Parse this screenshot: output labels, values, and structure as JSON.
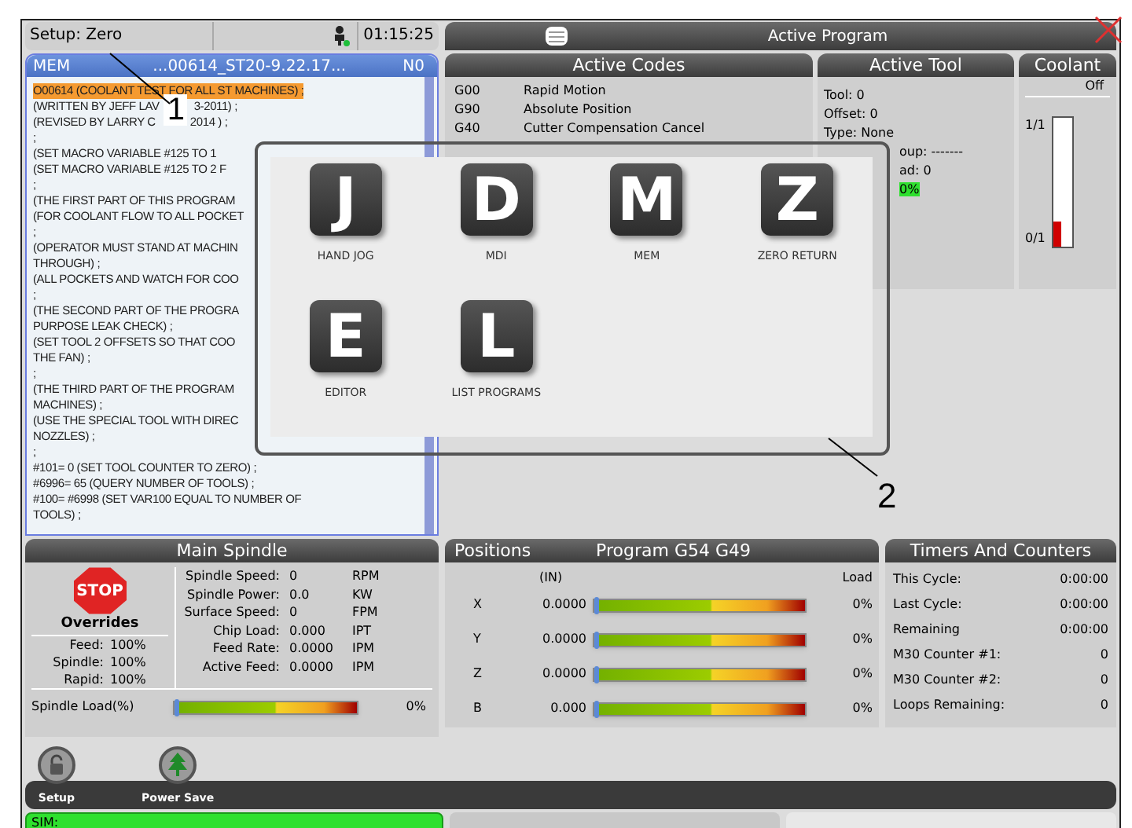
{
  "status_header": {
    "mode": "Setup: Zero",
    "time": "01:15:25"
  },
  "title_bar": {
    "title": "Active Program"
  },
  "program_panel": {
    "mode": "MEM",
    "name": "...00614_ST20-9.22.17...",
    "line": "N0",
    "lines": [
      {
        "text": "O00614 (COOLANT TEST FOR ALL ST MACHINES) ;",
        "selected": true
      },
      {
        "text": "(WRITTEN BY JEFF LAV",
        "after": "3-2011) ;",
        "selected": false
      },
      {
        "text": "(REVISED BY LARRY C",
        "after": "2014 ) ;",
        "selected": false
      },
      {
        "text": ";",
        "selected": false
      },
      {
        "text": "(SET MACRO VARIABLE #125 TO 1",
        "selected": false
      },
      {
        "text": "(SET MACRO VARIABLE #125 TO 2 F",
        "selected": false
      },
      {
        "text": ";",
        "selected": false
      },
      {
        "text": "(THE FIRST PART OF THIS PROGRAM",
        "selected": false
      },
      {
        "text": "(FOR COOLANT FLOW TO ALL POCKET",
        "selected": false
      },
      {
        "text": ";",
        "selected": false
      },
      {
        "text": "(OPERATOR MUST STAND AT MACHIN",
        "selected": false
      },
      {
        "text": "THROUGH) ;",
        "selected": false
      },
      {
        "text": "(ALL POCKETS AND WATCH FOR COO",
        "selected": false
      },
      {
        "text": ";",
        "selected": false
      },
      {
        "text": "(THE SECOND PART OF THE PROGRA",
        "selected": false
      },
      {
        "text": "PURPOSE LEAK CHECK) ;",
        "selected": false
      },
      {
        "text": "(SET TOOL 2 OFFSETS SO THAT COO",
        "selected": false
      },
      {
        "text": "THE FAN) ;",
        "selected": false
      },
      {
        "text": ";",
        "selected": false
      },
      {
        "text": "(THE THIRD PART OF THE PROGRAM",
        "selected": false
      },
      {
        "text": "MACHINES) ;",
        "selected": false
      },
      {
        "text": "(USE THE SPECIAL TOOL WITH DIREC",
        "selected": false
      },
      {
        "text": "NOZZLES) ;",
        "selected": false
      },
      {
        "text": ";",
        "selected": false
      },
      {
        "text": "#101= 0 (SET TOOL COUNTER TO ZERO) ;",
        "selected": false
      },
      {
        "text": "#6996= 65 (QUERY NUMBER OF TOOLS) ;",
        "selected": false
      },
      {
        "text": "#100= #6998 (SET VAR100 EQUAL TO NUMBER OF",
        "selected": false
      },
      {
        "text": "TOOLS) ;",
        "selected": false
      }
    ]
  },
  "active_codes": {
    "title": "Active Codes",
    "rows": [
      {
        "code": "G00",
        "description": "Rapid Motion"
      },
      {
        "code": "G90",
        "description": "Absolute Position"
      },
      {
        "code": "G40",
        "description": "Cutter Compensation Cancel"
      }
    ]
  },
  "active_tool": {
    "title": "Active Tool",
    "rows": [
      {
        "kind": "full",
        "text": "Tool: 0"
      },
      {
        "kind": "full",
        "text": "Offset: 0"
      },
      {
        "kind": "full",
        "text": "Type: None"
      },
      {
        "kind": "clipped",
        "text": "oup: -------"
      },
      {
        "kind": "clipped",
        "text": "ad: 0"
      },
      {
        "kind": "highlight",
        "text": "0%"
      }
    ]
  },
  "coolant": {
    "title": "Coolant",
    "state": "Off",
    "top_label": "1/1",
    "bottom_label": "0/1",
    "level": 0.2
  },
  "mode_menu": {
    "items": [
      {
        "key": "J",
        "label": "HAND JOG"
      },
      {
        "key": "D",
        "label": "MDI"
      },
      {
        "key": "M",
        "label": "MEM"
      },
      {
        "key": "Z",
        "label": "ZERO RETURN"
      },
      {
        "key": "E",
        "label": "EDITOR"
      },
      {
        "key": "L",
        "label": "LIST PROGRAMS"
      }
    ]
  },
  "callouts": [
    {
      "label": "1"
    },
    {
      "label": "2"
    }
  ],
  "main_spindle": {
    "title": "Main Spindle",
    "stop_label": "STOP",
    "overrides_title": "Overrides",
    "overrides": [
      {
        "label": "Feed:",
        "value": "100%"
      },
      {
        "label": "Spindle:",
        "value": "100%"
      },
      {
        "label": "Rapid:",
        "value": "100%"
      }
    ],
    "readings": [
      {
        "label": "Spindle Speed:",
        "value": "0",
        "unit": "RPM"
      },
      {
        "label": "Spindle Power:",
        "value": "0.0",
        "unit": "KW"
      },
      {
        "label": "Surface Speed:",
        "value": "0",
        "unit": "FPM"
      },
      {
        "label": "Chip Load:",
        "value": "0.000",
        "unit": "IPT"
      },
      {
        "label": "Feed Rate:",
        "value": "0.0000",
        "unit": "IPM"
      },
      {
        "label": "Active Feed:",
        "value": "0.0000",
        "unit": "IPM"
      }
    ],
    "load": {
      "label": "Spindle Load(%)",
      "level": 0,
      "reading": "0%"
    }
  },
  "positions": {
    "title": "Positions",
    "program": "Program G54 G49",
    "unit_header": "(IN)",
    "load_header": "Load",
    "axes": [
      {
        "axis": "X",
        "value": "0.0000",
        "level": 0,
        "reading": "0%"
      },
      {
        "axis": "Y",
        "value": "0.0000",
        "level": 0,
        "reading": "0%"
      },
      {
        "axis": "Z",
        "value": "0.0000",
        "level": 0,
        "reading": "0%"
      },
      {
        "axis": "B",
        "value": "0.000",
        "level": 0,
        "reading": "0%"
      }
    ]
  },
  "timers": {
    "title": "Timers And Counters",
    "rows": [
      {
        "label": "This Cycle:",
        "value": "0:00:00"
      },
      {
        "label": "Last Cycle:",
        "value": "0:00:00"
      },
      {
        "label": "Remaining",
        "value": "0:00:00"
      },
      {
        "label": "M30 Counter #1:",
        "value": "0"
      },
      {
        "label": "M30 Counter #2:",
        "value": "0"
      },
      {
        "label": "Loops Remaining:",
        "value": "0"
      }
    ]
  },
  "toolbar": [
    {
      "kind": "lock",
      "label": "Setup"
    },
    {
      "kind": "tree",
      "label": "Power Save"
    }
  ],
  "status_bar": {
    "sim": "SIM:"
  }
}
